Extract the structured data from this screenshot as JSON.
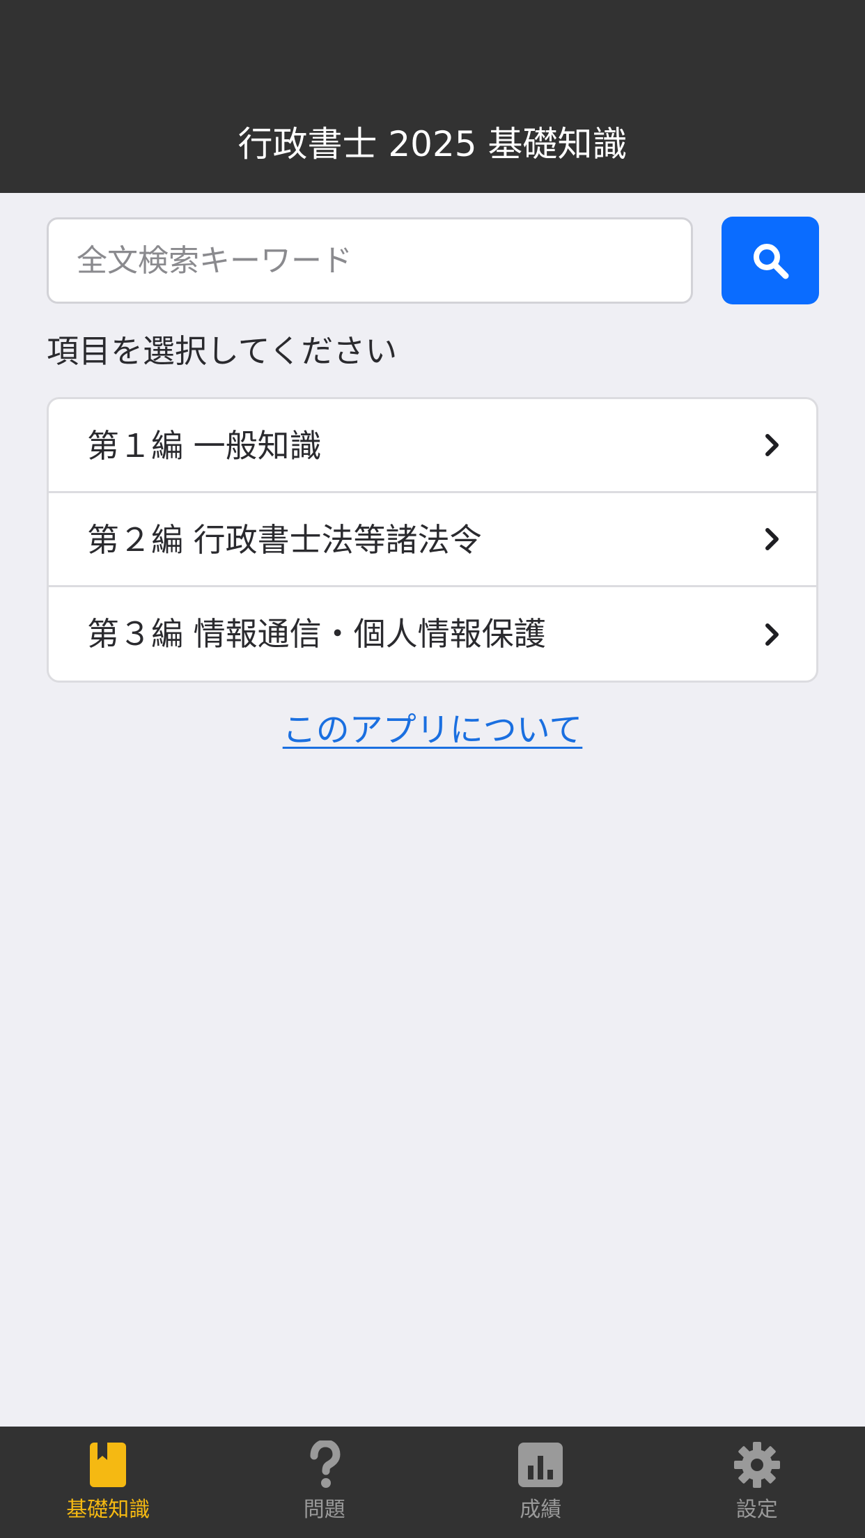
{
  "header": {
    "title": "行政書士 2025 基礎知識"
  },
  "search": {
    "placeholder": "全文検索キーワード",
    "value": "",
    "button_icon": "search-icon",
    "button_color": "#0a6cff"
  },
  "prompt": "項目を選択してください",
  "sections": [
    {
      "label": "第１編 一般知識"
    },
    {
      "label": "第２編 行政書士法等諸法令"
    },
    {
      "label": "第３編 情報通信・個人情報保護"
    }
  ],
  "about_link": "このアプリについて",
  "tabs": [
    {
      "label": "基礎知識",
      "icon": "book-icon",
      "active": true
    },
    {
      "label": "問題",
      "icon": "question-icon",
      "active": false
    },
    {
      "label": "成績",
      "icon": "chart-icon",
      "active": false
    },
    {
      "label": "設定",
      "icon": "gear-icon",
      "active": false
    }
  ],
  "colors": {
    "header_bg": "#323232",
    "page_bg": "#efeff4",
    "accent": "#0a6cff",
    "link": "#1a6fe0",
    "tab_active": "#f5b912",
    "tab_inactive": "#9a9a9a"
  }
}
